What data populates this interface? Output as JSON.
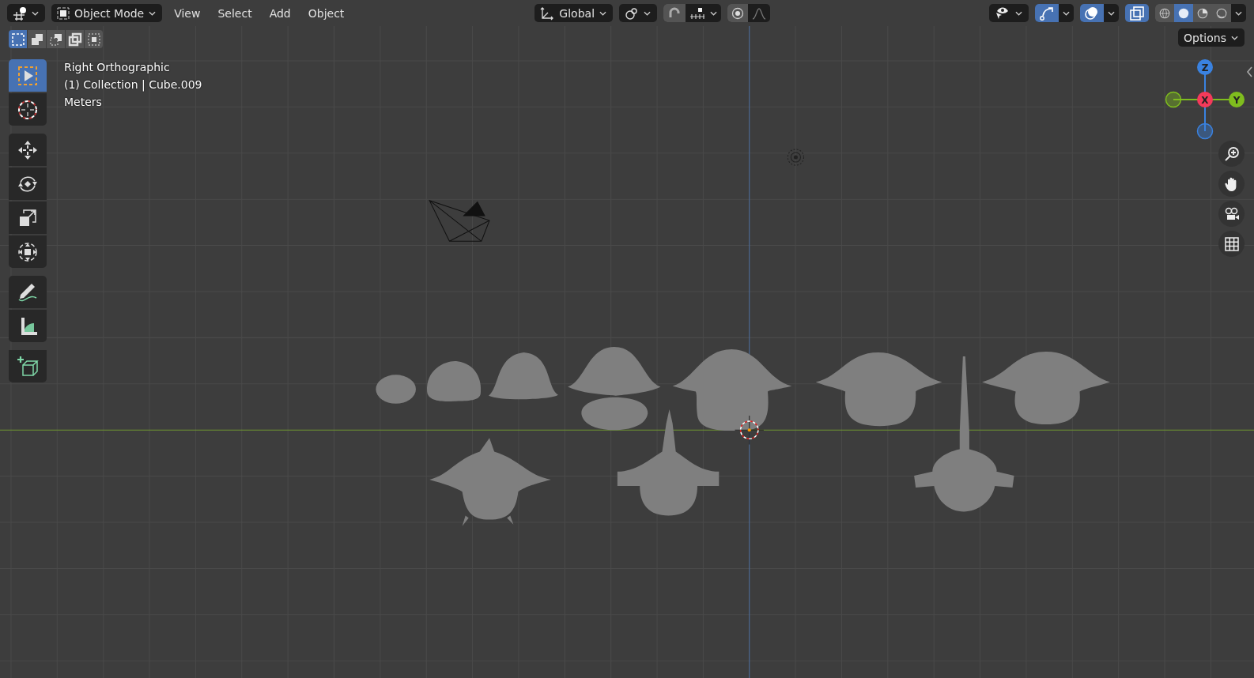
{
  "header": {
    "mode": "Object Mode",
    "menus": [
      "View",
      "Select",
      "Add",
      "Object"
    ],
    "orientation": "Global",
    "viewport_toggles": [
      {
        "kind": "gizmos",
        "on": true
      },
      {
        "kind": "overlays",
        "on": true
      },
      {
        "kind": "xray",
        "on": true
      }
    ],
    "shading": [
      {
        "kind": "wireframe",
        "selected": false
      },
      {
        "kind": "solid",
        "selected": true
      },
      {
        "kind": "material",
        "selected": false
      },
      {
        "kind": "rendered",
        "selected": false
      }
    ]
  },
  "select_modes": [
    {
      "kind": "new",
      "selected": true
    },
    {
      "kind": "extend",
      "selected": false
    },
    {
      "kind": "subtract",
      "selected": false
    },
    {
      "kind": "invert",
      "selected": false
    },
    {
      "kind": "intersect",
      "selected": false
    }
  ],
  "options_button": "Options",
  "tools": [
    {
      "kind": "select",
      "selected": true
    },
    {
      "kind": "cursor",
      "selected": false
    },
    {
      "kind": "move",
      "selected": false
    },
    {
      "kind": "rotate",
      "selected": false
    },
    {
      "kind": "scale",
      "selected": false
    },
    {
      "kind": "transform",
      "selected": false
    },
    {
      "kind": "annotate",
      "selected": false
    },
    {
      "kind": "measure",
      "selected": false
    },
    {
      "kind": "add_cube",
      "selected": false
    }
  ],
  "viewport_info": [
    "Right Orthographic",
    "(1) Collection | Cube.009",
    "Meters"
  ],
  "axis_gizmo": [
    {
      "label": "Z",
      "color": "#3a82e0"
    },
    {
      "label": "X",
      "color": "#f43a5a"
    },
    {
      "label": "Y",
      "color": "#7fbd1e"
    }
  ]
}
